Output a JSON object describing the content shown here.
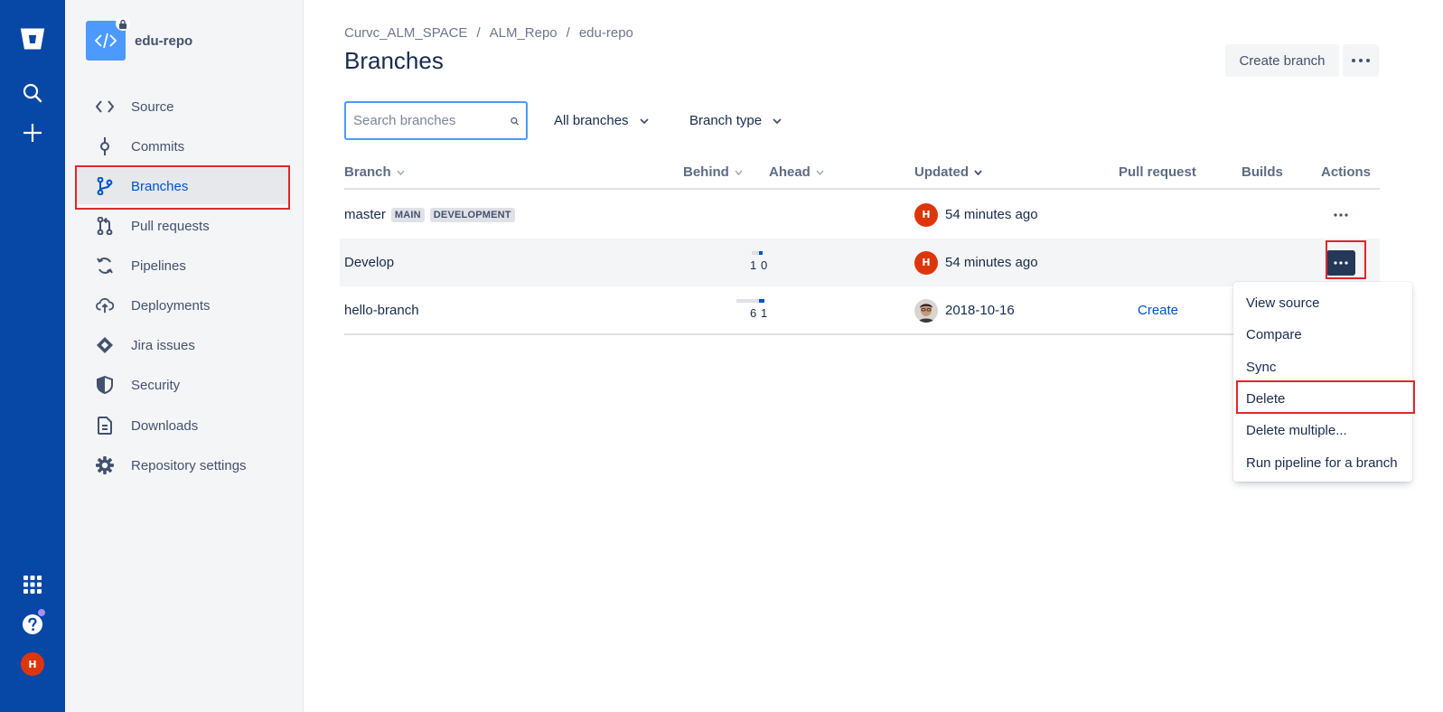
{
  "global_nav": {
    "icons": [
      "bitbucket-logo",
      "search-icon",
      "plus-icon",
      "app-switcher-icon",
      "help-icon"
    ],
    "avatar_initial": "H"
  },
  "sidebar": {
    "repo_name": "edu-repo",
    "items": [
      {
        "label": "Source",
        "icon": "source-code-icon"
      },
      {
        "label": "Commits",
        "icon": "commits-icon"
      },
      {
        "label": "Branches",
        "icon": "branches-icon",
        "active": true
      },
      {
        "label": "Pull requests",
        "icon": "pull-requests-icon"
      },
      {
        "label": "Pipelines",
        "icon": "pipelines-icon"
      },
      {
        "label": "Deployments",
        "icon": "deployments-icon"
      },
      {
        "label": "Jira issues",
        "icon": "jira-icon"
      },
      {
        "label": "Security",
        "icon": "shield-icon"
      },
      {
        "label": "Downloads",
        "icon": "downloads-icon"
      },
      {
        "label": "Repository settings",
        "icon": "gear-icon"
      }
    ]
  },
  "breadcrumb": [
    "Curvc_ALM_SPACE",
    "ALM_Repo",
    "edu-repo"
  ],
  "breadcrumb_sep": "/",
  "page_title": "Branches",
  "toolbar": {
    "create_branch": "Create branch"
  },
  "search": {
    "placeholder": "Search branches",
    "value": ""
  },
  "filters": {
    "all_branches": "All branches",
    "branch_type": "Branch type"
  },
  "table": {
    "headers": {
      "branch": "Branch",
      "behind": "Behind",
      "ahead": "Ahead",
      "updated": "Updated",
      "pull_request": "Pull request",
      "builds": "Builds",
      "actions": "Actions"
    },
    "rows": [
      {
        "name": "master",
        "lozenges": [
          "MAIN",
          "DEVELOPMENT"
        ],
        "behind": null,
        "ahead": null,
        "updated": "54 minutes ago",
        "avatar": "H",
        "pull_request": ""
      },
      {
        "name": "Develop",
        "lozenges": [],
        "behind": "1",
        "ahead": "0",
        "updated": "54 minutes ago",
        "avatar": "H",
        "pull_request": ""
      },
      {
        "name": "hello-branch",
        "lozenges": [],
        "behind": "6",
        "ahead": "1",
        "updated": "2018-10-16",
        "avatar": "photo",
        "pull_request": "Create"
      }
    ]
  },
  "dropdown": {
    "items": [
      "View source",
      "Compare",
      "Sync",
      "Delete",
      "Delete multiple...",
      "Run pipeline for a branch"
    ]
  },
  "colors": {
    "global_nav": "#0747a6",
    "link": "#0052cc",
    "highlight": "#e1262c",
    "avatar": "#de350b"
  }
}
